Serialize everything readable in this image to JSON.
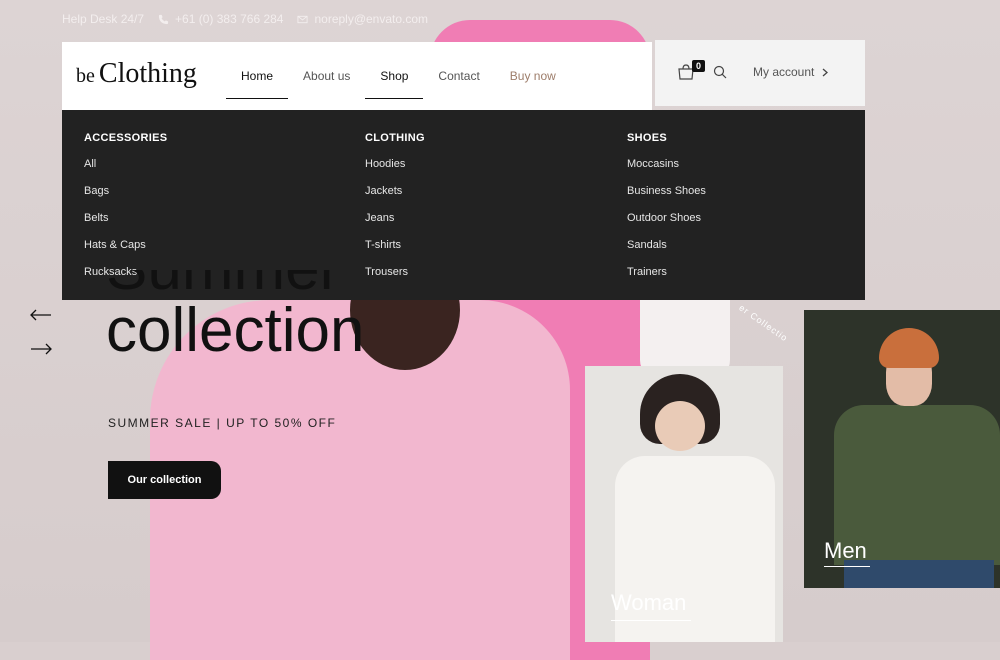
{
  "topbar": {
    "helpdesk": "Help Desk 24/7",
    "phone": "+61 (0) 383 766 284",
    "email": "noreply@envato.com"
  },
  "logo": {
    "prefix": "be",
    "name": "Clothing"
  },
  "nav": [
    {
      "label": "Home"
    },
    {
      "label": "About us"
    },
    {
      "label": "Shop"
    },
    {
      "label": "Contact"
    },
    {
      "label": "Buy now"
    }
  ],
  "header_right": {
    "cart_count": "0",
    "account_label": "My account"
  },
  "mega_menu": {
    "columns": [
      {
        "heading": "ACCESSORIES",
        "items": [
          "All",
          "Bags",
          "Belts",
          "Hats & Caps",
          "Rucksacks"
        ]
      },
      {
        "heading": "CLOTHING",
        "items": [
          "Hoodies",
          "Jackets",
          "Jeans",
          "T-shirts",
          "Trousers"
        ]
      },
      {
        "heading": "SHOES",
        "items": [
          "Moccasins",
          "Business Shoes",
          "Outdoor Shoes",
          "Sandals",
          "Trainers"
        ]
      }
    ]
  },
  "hero": {
    "title_line1": "Summer",
    "title_line2": "collection",
    "subtitle": "SUMMER SALE | UP TO 50% OFF",
    "button": "Our collection",
    "curve_text": "er Collectio"
  },
  "cards": {
    "woman": "Woman",
    "men": "Men"
  },
  "icons": {
    "prev": "arrow-left-icon",
    "next": "arrow-right-icon",
    "phone": "phone-icon",
    "email": "envelope-icon",
    "cart": "cart-icon",
    "search": "search-icon",
    "chevron": "chevron-right-icon"
  },
  "colors": {
    "menu_bg": "#222222",
    "accent_buy": "#9d7d6a",
    "button_bg": "#111111",
    "jacket_pink": "#f07db4"
  }
}
